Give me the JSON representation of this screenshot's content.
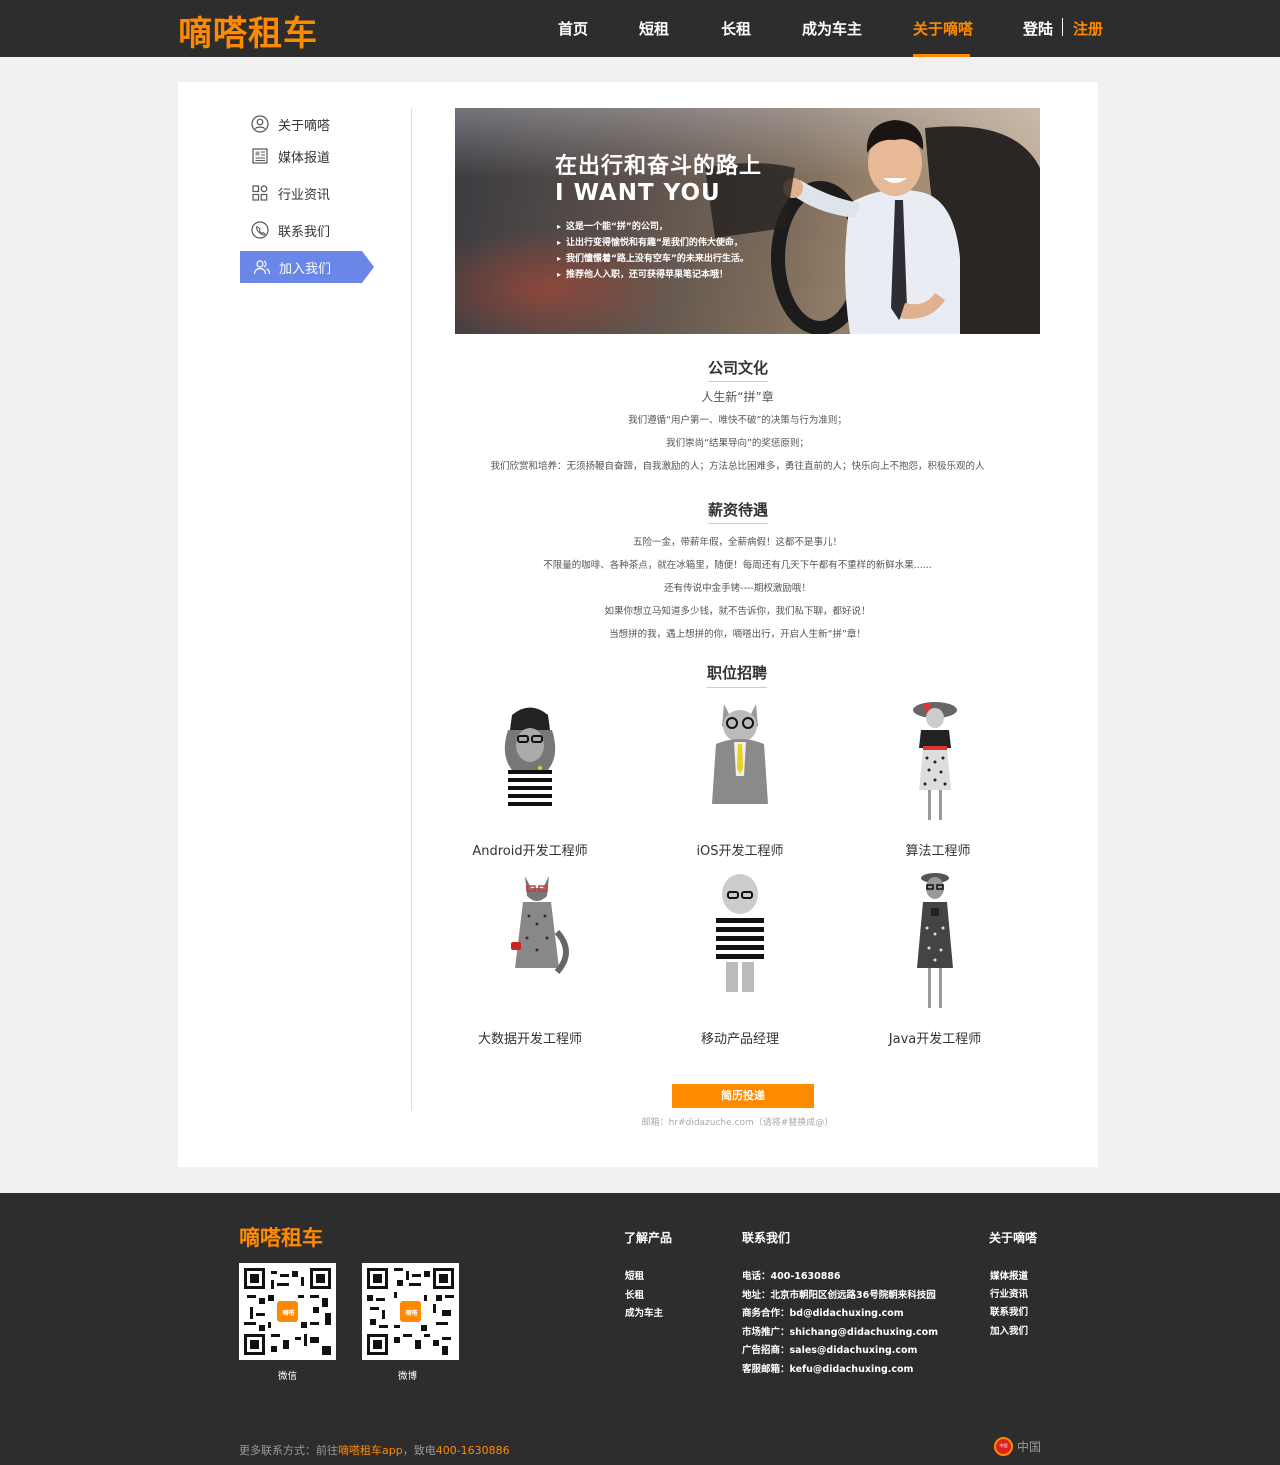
{
  "header": {
    "logo": "嘀嗒租车",
    "nav": [
      "首页",
      "短租",
      "长租",
      "成为车主",
      "关于嘀嗒"
    ],
    "login": "登陆",
    "register": "注册"
  },
  "sidebar": {
    "items": [
      {
        "label": "关于嘀嗒",
        "icon": "user-circle-icon"
      },
      {
        "label": "媒体报道",
        "icon": "newspaper-icon"
      },
      {
        "label": "行业资讯",
        "icon": "grid-icon"
      },
      {
        "label": "联系我们",
        "icon": "phone-icon"
      },
      {
        "label": "加入我们",
        "icon": "users-icon"
      }
    ]
  },
  "banner": {
    "title": "在出行和奋斗的路上",
    "subtitle": "I WANT YOU",
    "bullets": [
      "这是一个能“拼”的公司，",
      "让出行变得愉悦和有趣“是我们的伟大使命，",
      "我们憧憬着“路上没有空车”的未来出行生活。",
      "推荐他人入职，还可获得苹果笔记本哦！"
    ]
  },
  "culture": {
    "title": "公司文化",
    "slogan": "人生新“拼”章",
    "lines": [
      "我们遵循“用户第一、唯快不破”的决策与行为准则；",
      "我们崇尚“结果导向”的奖惩原则；",
      "我们欣赏和培养：无须扬鞭自奋蹄，自我激励的人；方法总比困难多，勇往直前的人；快乐向上不抱怨，积极乐观的人"
    ]
  },
  "salary": {
    "title": "薪资待遇",
    "lines": [
      "五险一金，带薪年假，全薪病假！这都不是事儿！",
      "不限量的咖啡、各种茶点，就在冰箱里，随便！每周还有几天下午都有不重样的新鲜水果......",
      "还有传说中金手铐----期权激励哦！",
      "如果你想立马知道多少钱，就不告诉你，我们私下聊，都好说！",
      "当想拼的我，遇上想拼的你，嘀嗒出行，开启人生新“拼”章！"
    ]
  },
  "jobs": {
    "title": "职位招聘",
    "items": [
      {
        "name": "Android开发工程师",
        "icon": "lion-hipster-illustration"
      },
      {
        "name": "iOS开发工程师",
        "icon": "cat-suit-illustration"
      },
      {
        "name": "算法工程师",
        "icon": "lady-hat-illustration"
      },
      {
        "name": "大数据开发工程师",
        "icon": "fox-dress-illustration"
      },
      {
        "name": "移动产品经理",
        "icon": "old-man-sweater-illustration"
      },
      {
        "name": "Java开发工程师",
        "icon": "deer-dress-illustration"
      }
    ]
  },
  "cta": {
    "label": "简历投递",
    "email_note": "邮箱：hr#didazuche.com（请将#替换成@）"
  },
  "footer": {
    "logo": "嘀嗒租车",
    "qr": [
      {
        "label": "微信"
      },
      {
        "label": "微博"
      }
    ],
    "qr_badge": "嘀嗒",
    "products": {
      "title": "了解产品",
      "links": [
        "短租",
        "长租",
        "成为车主"
      ]
    },
    "contact": {
      "title": "联系我们",
      "lines": [
        "电话：400-1630886",
        "地址：北京市朝阳区创远路36号院朝来科技园",
        "商务合作：bd@didachuxing.com",
        "市场推广：shichang@didachuxing.com",
        "广告招商：sales@didachuxing.com",
        "客服邮箱：kefu@didachuxing.com"
      ]
    },
    "about": {
      "title": "关于嘀嗒",
      "links": [
        "媒体报道",
        "行业资讯",
        "联系我们",
        "加入我们"
      ]
    },
    "bottom": {
      "prefix": "更多联系方式：前往",
      "app": "嘀嗒租车app",
      "mid": "，致电",
      "phone": "400-1630886"
    },
    "region": "中国",
    "region_badge": "中国"
  },
  "colors": {
    "accent": "#ff8a00",
    "sidebar_active": "#6a86e6",
    "dark": "#2d2d2d"
  }
}
